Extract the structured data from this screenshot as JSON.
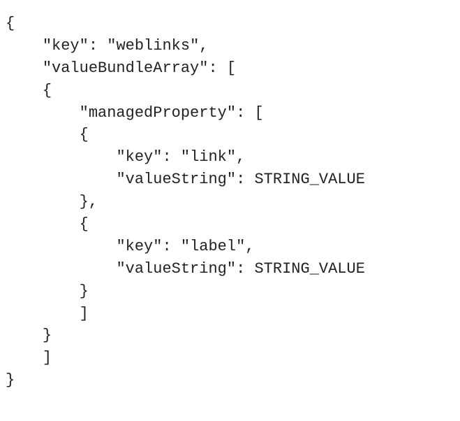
{
  "code": {
    "brace_open": "{",
    "brace_close": "}",
    "bracket_open": "[",
    "bracket_close": "]",
    "comma": ",",
    "colon_space": ": ",
    "q": "\"",
    "key_token": "key",
    "valueBundleArray_token": "valueBundleArray",
    "managedProperty_token": "managedProperty",
    "valueString_token": "valueString",
    "weblinks_value": "weblinks",
    "link_value": "link",
    "label_value": "label",
    "string_value_token": "STRING_VALUE"
  }
}
